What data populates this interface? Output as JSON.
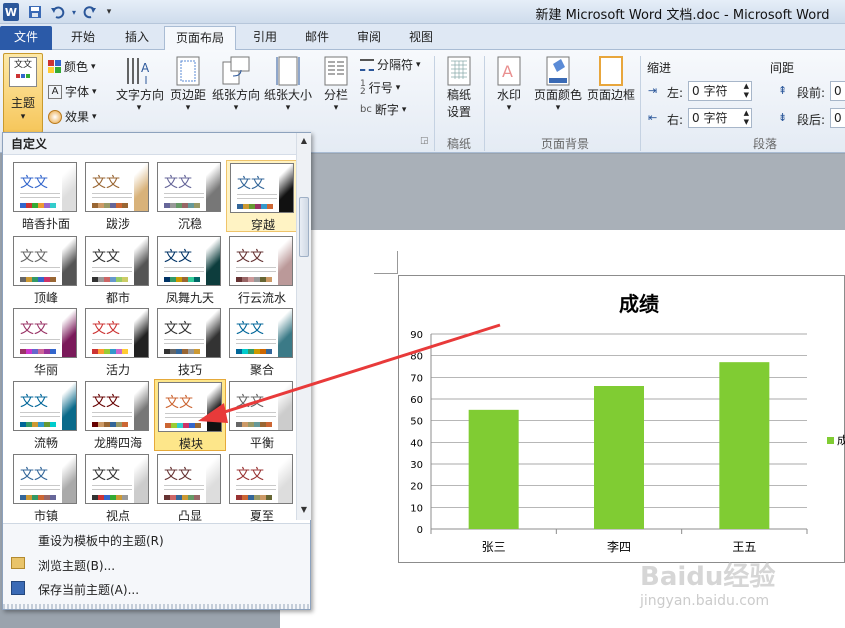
{
  "window": {
    "title": "新建 Microsoft Word 文档.doc - Microsoft Word"
  },
  "qat": {
    "word_icon": "W",
    "save_icon": "save-icon",
    "undo_icon": "undo-icon",
    "redo_icon": "redo-icon"
  },
  "tabs": [
    "文件",
    "开始",
    "插入",
    "页面布局",
    "引用",
    "邮件",
    "审阅",
    "视图"
  ],
  "ribbon": {
    "theme_label": "主题",
    "colors": "颜色",
    "fonts": "字体",
    "effects": "效果",
    "text_direction": "文字方向",
    "margins": "页边距",
    "orientation": "纸张方向",
    "size": "纸张大小",
    "columns": "分栏",
    "breaks": "分隔符",
    "line_numbers": "行号",
    "hyphenation": "断字",
    "manuscript_label1": "稿纸",
    "manuscript_label2": "设置",
    "manuscript_group": "稿纸",
    "watermark": "水印",
    "page_color": "页面颜色",
    "page_borders": "页面边框",
    "page_bg_group": "页面背景",
    "indent": "缩进",
    "indent_left": "左:",
    "indent_right": "右:",
    "indent_left_value": "0 字符",
    "indent_right_value": "0 字符",
    "spacing": "间距",
    "before": "段前:",
    "after": "段后:",
    "before_value": "0",
    "after_value": "0",
    "paragraph_group": "段落"
  },
  "gallery": {
    "header": "自定义",
    "themes": [
      "暗香扑面",
      "跋涉",
      "沉稳",
      "穿越",
      "顶峰",
      "都市",
      "凤舞九天",
      "行云流水",
      "华丽",
      "活力",
      "技巧",
      "聚合",
      "流畅",
      "龙腾四海",
      "模块",
      "平衡",
      "市镇",
      "视点",
      "凸显",
      "夏至"
    ],
    "thumb_text": "文文",
    "menu": [
      "重设为模板中的主题(R)",
      "浏览主题(B)...",
      "保存当前主题(A)..."
    ]
  },
  "chart_data": {
    "type": "bar",
    "title": "成绩",
    "categories": [
      "张三",
      "李四",
      "王五"
    ],
    "values": [
      55,
      66,
      77
    ],
    "ylim": [
      0,
      90
    ],
    "yticks": [
      0,
      10,
      20,
      30,
      40,
      50,
      60,
      70,
      80,
      90
    ],
    "color": "#80cc33",
    "grid": true,
    "legend_visible_text": "成"
  },
  "watermark": {
    "text1": "Baidu经验",
    "text2": "jingyan.baidu.com"
  }
}
